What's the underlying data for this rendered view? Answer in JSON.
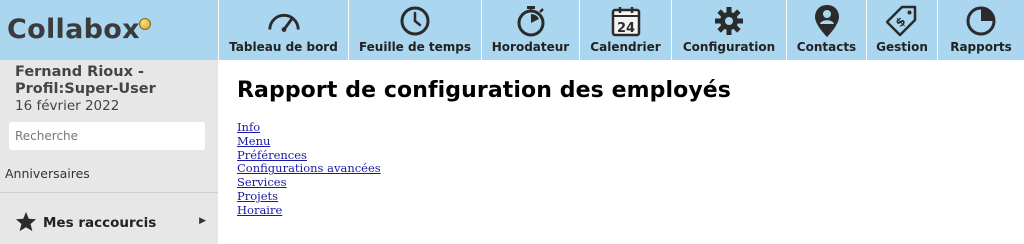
{
  "app": {
    "logo": "Collabox"
  },
  "nav": [
    {
      "label": "Tableau de bord",
      "icon": "gauge-icon"
    },
    {
      "label": "Feuille de temps",
      "icon": "clock-icon"
    },
    {
      "label": "Horodateur",
      "icon": "stopwatch-icon"
    },
    {
      "label": "Calendrier",
      "icon": "calendar-icon",
      "day": "24"
    },
    {
      "label": "Configuration",
      "icon": "gear-icon"
    },
    {
      "label": "Contacts",
      "icon": "contact-pin-icon"
    },
    {
      "label": "Gestion",
      "icon": "price-tag-icon"
    },
    {
      "label": "Rapports",
      "icon": "pie-chart-icon"
    }
  ],
  "sidebar": {
    "user_name": "Fernand Rioux - Profil:Super-User",
    "date": "16 février 2022",
    "search_placeholder": "Recherche",
    "birthdays": "Anniversaires",
    "shortcuts": "Mes raccourcis"
  },
  "main": {
    "title": "Rapport de configuration des employés",
    "links": [
      "Info",
      "Menu",
      "Préférences",
      "Configurations avancées",
      "Services",
      "Projets",
      "Horaire"
    ]
  },
  "colors": {
    "topbar": "#aad6f0",
    "sidebar": "#e7e7e7",
    "link": "#1a1aa6"
  }
}
